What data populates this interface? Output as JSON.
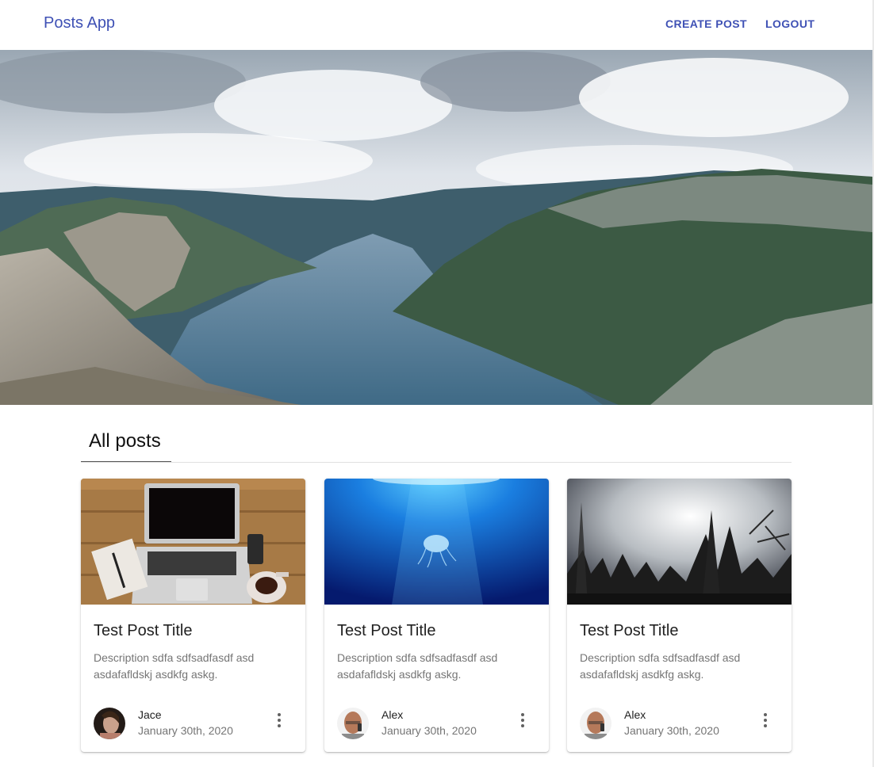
{
  "header": {
    "brand": "Posts App",
    "nav": {
      "create_post": "CREATE POST",
      "logout": "LOGOUT"
    }
  },
  "section": {
    "title": "All posts"
  },
  "posts": [
    {
      "title": "Test Post Title",
      "description": "Description sdfa sdfsadfasdf asd asdafafldskj asdkfg askg.",
      "author": "Jace",
      "date": "January 30th, 2020",
      "image": "laptop-desk-photo"
    },
    {
      "title": "Test Post Title",
      "description": "Description sdfa sdfsadfasdf asd asdafafldskj asdkfg askg.",
      "author": "Alex",
      "date": "January 30th, 2020",
      "image": "jellyfish-underwater-photo"
    },
    {
      "title": "Test Post Title",
      "description": "Description sdfa sdfsadfasdf asd asdafafldskj asdkfg askg.",
      "author": "Alex",
      "date": "January 30th, 2020",
      "image": "misty-forest-photo"
    }
  ],
  "colors": {
    "primary": "#3f51b5",
    "text": "#212121",
    "secondary_text": "#757575"
  }
}
